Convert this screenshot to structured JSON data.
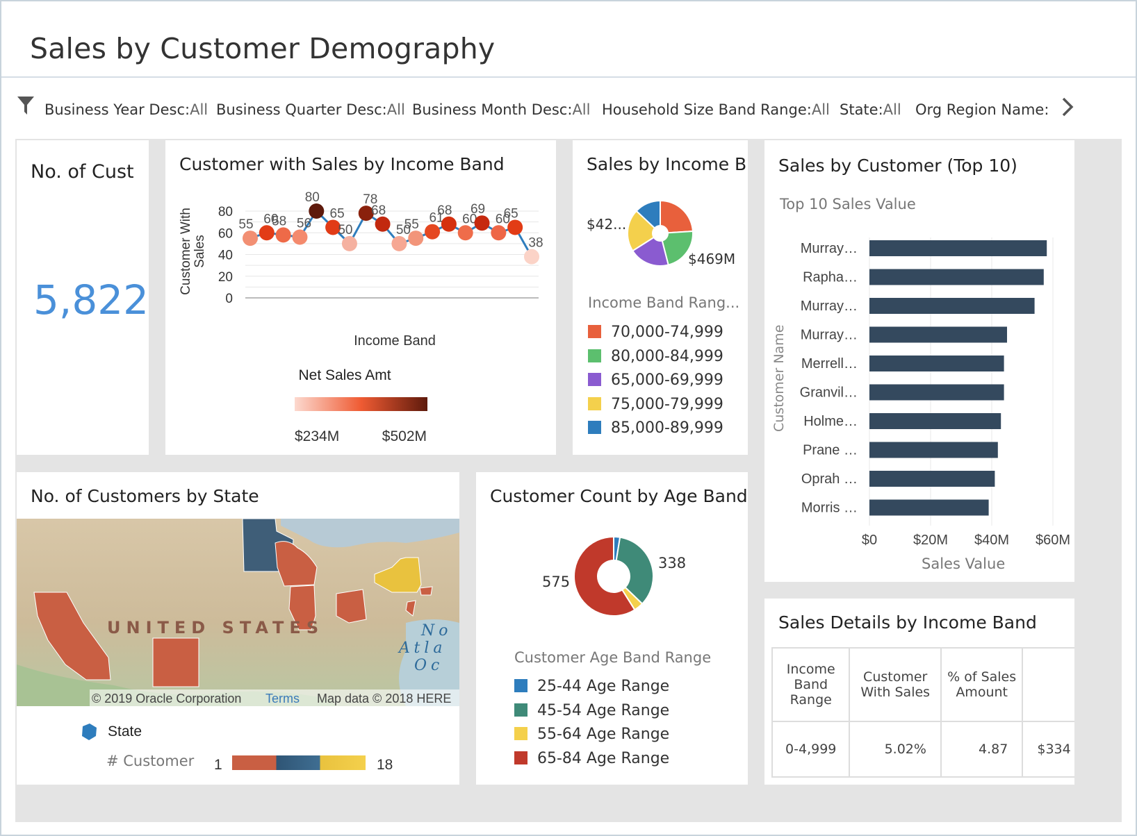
{
  "page": {
    "title": "Sales by Customer Demography"
  },
  "filters": [
    {
      "label": "Business Year Desc:",
      "value": "All"
    },
    {
      "label": "Business Quarter Desc:",
      "value": "All"
    },
    {
      "label": "Business Month Desc:",
      "value": "All"
    },
    {
      "label": "Household Size Band Range:",
      "value": "All"
    },
    {
      "label": "State:",
      "value": "All"
    },
    {
      "label": "Org Region Name:",
      "value": ""
    }
  ],
  "kpi": {
    "title": "No. of Cust",
    "value": "5,822",
    "color": "#4a90d9"
  },
  "line_chart": {
    "title": "Customer with Sales by Income Band",
    "ylabel_line1": "Customer With",
    "ylabel_line2": "Sales",
    "xlabel": "Income Band",
    "yticks": [
      "80",
      "60",
      "40",
      "20",
      "0"
    ],
    "color_legend_title": "Net Sales Amt",
    "color_min": "$234M",
    "color_max": "$502M"
  },
  "pie_income": {
    "title": "Sales by Income Bar",
    "label_left": "$42...",
    "label_right": "$469M",
    "legend_title": "Income Band Rang...",
    "legend": [
      {
        "label": "70,000-74,999",
        "color": "#e8603c"
      },
      {
        "label": "80,000-84,999",
        "color": "#5cbf6e"
      },
      {
        "label": "65,000-69,999",
        "color": "#8a5bd0"
      },
      {
        "label": "75,000-79,999",
        "color": "#f4d04c"
      },
      {
        "label": "85,000-89,999",
        "color": "#2e7dbd"
      }
    ]
  },
  "top10": {
    "title": "Sales by Customer (Top 10)",
    "subtitle": "Top 10 Sales Value",
    "ylabel": "Customer Name",
    "xlabel": "Sales Value",
    "xticks": [
      "$0",
      "$20M",
      "$40M",
      "$60M"
    ]
  },
  "map": {
    "title": "No. of Customers by State",
    "country_label": "UNITED STATES",
    "ocean_label_1": "No",
    "ocean_label_2": "Atla",
    "ocean_label_3": "Oc",
    "copyright": "© 2019 Oracle Corporation",
    "terms": "Terms",
    "mapdata": "Map data © 2018 HERE",
    "legend_state": "State",
    "legend_customer": "# Customer",
    "scale_min": "1",
    "scale_max": "18"
  },
  "age_donut": {
    "title": "Customer Count by Age Band",
    "label_left": "575",
    "label_right": "338",
    "legend_title": "Customer Age Band Range",
    "legend": [
      {
        "label": "25-44 Age Range",
        "color": "#2e7dbd"
      },
      {
        "label": "45-54 Age Range",
        "color": "#3f8a78"
      },
      {
        "label": "55-64 Age Range",
        "color": "#f4d04c"
      },
      {
        "label": "65-84 Age Range",
        "color": "#c0392b"
      }
    ]
  },
  "details": {
    "title": "Sales Details by Income Band",
    "headers": [
      "Income Band Range",
      "Customer With Sales",
      "% of Sales Amount",
      ""
    ],
    "rows": [
      [
        "0-4,999",
        "5.02%",
        "4.87",
        "$334"
      ]
    ]
  },
  "chart_data": [
    {
      "type": "line",
      "title": "Customer with Sales by Income Band",
      "xlabel": "Income Band",
      "ylabel": "Customer With Sales",
      "ylim": [
        0,
        80
      ],
      "values": [
        55,
        60,
        58,
        56,
        80,
        65,
        50,
        78,
        68,
        50,
        55,
        61,
        68,
        60,
        69,
        60,
        65,
        38
      ],
      "net_sales_range": [
        "$234M",
        "$502M"
      ]
    },
    {
      "type": "pie",
      "title": "Sales by Income Bar",
      "categories": [
        "70,000-74,999",
        "80,000-84,999",
        "65,000-69,999",
        "75,000-79,999",
        "85,000-89,999"
      ],
      "values": [
        24,
        22,
        20,
        21,
        13
      ],
      "labels": [
        "$42...",
        "$469M"
      ]
    },
    {
      "type": "bar",
      "title": "Sales by Customer (Top 10)",
      "subtitle": "Top 10 Sales Value",
      "orientation": "horizontal",
      "xlabel": "Sales Value",
      "ylabel": "Customer Name",
      "categories": [
        "Murray…",
        "Rapha…",
        "Murray…",
        "Murray…",
        "Merrell…",
        "Granvil…",
        "Holme…",
        "Prane …",
        "Oprah …",
        "Morris …"
      ],
      "values": [
        58,
        57,
        54,
        45,
        44,
        44,
        43,
        42,
        41,
        39
      ],
      "unit": "$M",
      "xlim": [
        0,
        60
      ]
    },
    {
      "type": "pie",
      "title": "Customer Count by Age Band",
      "categories": [
        "25-44 Age Range",
        "45-54 Age Range",
        "55-64 Age Range",
        "65-84 Age Range"
      ],
      "values": [
        25,
        338,
        38,
        575
      ]
    }
  ]
}
